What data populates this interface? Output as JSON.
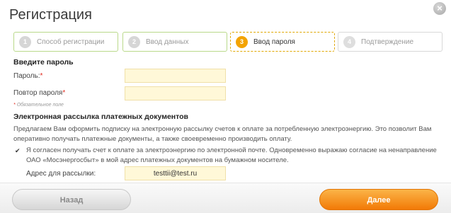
{
  "dialog": {
    "title": "Регистрация",
    "close_symbol": "×"
  },
  "steps": [
    {
      "number": "1",
      "label": "Способ регистрации",
      "state": "done"
    },
    {
      "number": "2",
      "label": "Ввод данных",
      "state": "done"
    },
    {
      "number": "3",
      "label": "Ввод пароля",
      "state": "active"
    },
    {
      "number": "4",
      "label": "Подтверждение",
      "state": "todo"
    }
  ],
  "password_section": {
    "heading": "Введите пароль",
    "password_label": "Пароль:",
    "password_value": "",
    "repeat_label": "Повтор пароля",
    "repeat_value": "",
    "required_mark": "*",
    "required_note": "Обязательное поле"
  },
  "mailing_section": {
    "heading": "Электронная рассылка платежных документов",
    "description_line1": "Предлагаем Вам оформить подписку на электронную рассылку счетов к оплате за потребленную электроэнергию. Это позволит Вам",
    "description_line2": "оперативно получать платежные документы, а также своевременно производить оплату.",
    "consent_checked": true,
    "consent_line1": "Я согласен получать счет к оплате за электроэнергию по электронной почте. Одновременно выражаю согласие на ненаправление",
    "consent_line2": "ОАО «Мосэнергосбыт» в мой адрес платежных документов на бумажном носителе.",
    "address_label": "Адрес для рассылки:",
    "address_value": "testtii@test.ru"
  },
  "footer": {
    "back_label": "Назад",
    "next_label": "Далее"
  }
}
